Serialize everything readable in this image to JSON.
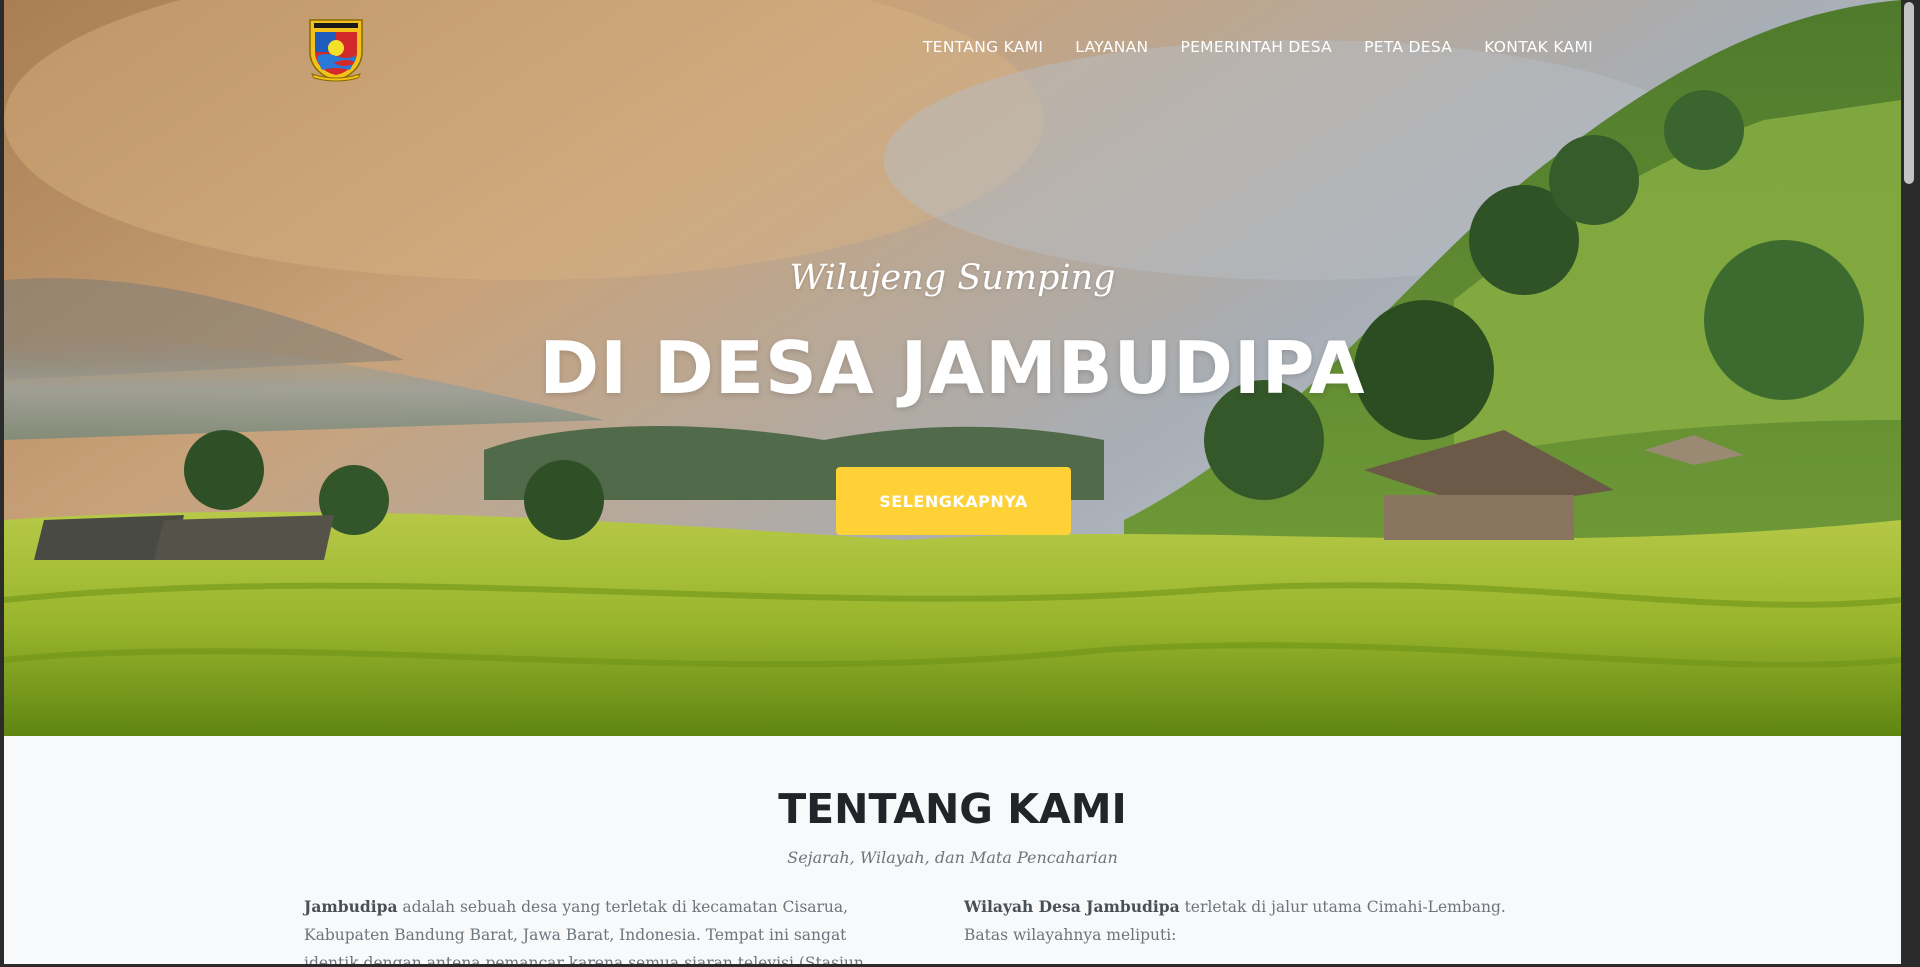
{
  "navbar": {
    "logo_alt": "Logo Desa Jambudipa",
    "links": [
      "TENTANG KAMI",
      "LAYANAN",
      "PEMERINTAH DESA",
      "PETA DESA",
      "KONTAK KAMI"
    ]
  },
  "hero": {
    "subheading": "Wilujeng Sumping",
    "heading": "DI DESA JAMBUDIPA",
    "button": "SELENGKAPNYA"
  },
  "about": {
    "title": "TENTANG KAMI",
    "subtitle": "Sejarah, Wilayah, dan Mata Pencaharian",
    "left_bold": "Jambudipa",
    "left_text": " adalah sebuah desa yang terletak di kecamatan Cisarua, Kabupaten Bandung Barat, Jawa Barat, Indonesia. Tempat ini sangat identik dengan antena pemancar karena semua siaran televisi (Stasiun Relai TV) berpusat di sini, tepatnya",
    "right_bold": "Wilayah Desa Jambudipa",
    "right_text": " terletak di jalur utama Cimahi-Lembang. Batas wilayahnya meliputi:"
  },
  "colors": {
    "accent": "#fed136",
    "heading": "#212529",
    "muted": "#6c757d",
    "section_bg": "#f8f9fa"
  },
  "icons": {
    "logo": "village-crest-icon"
  }
}
